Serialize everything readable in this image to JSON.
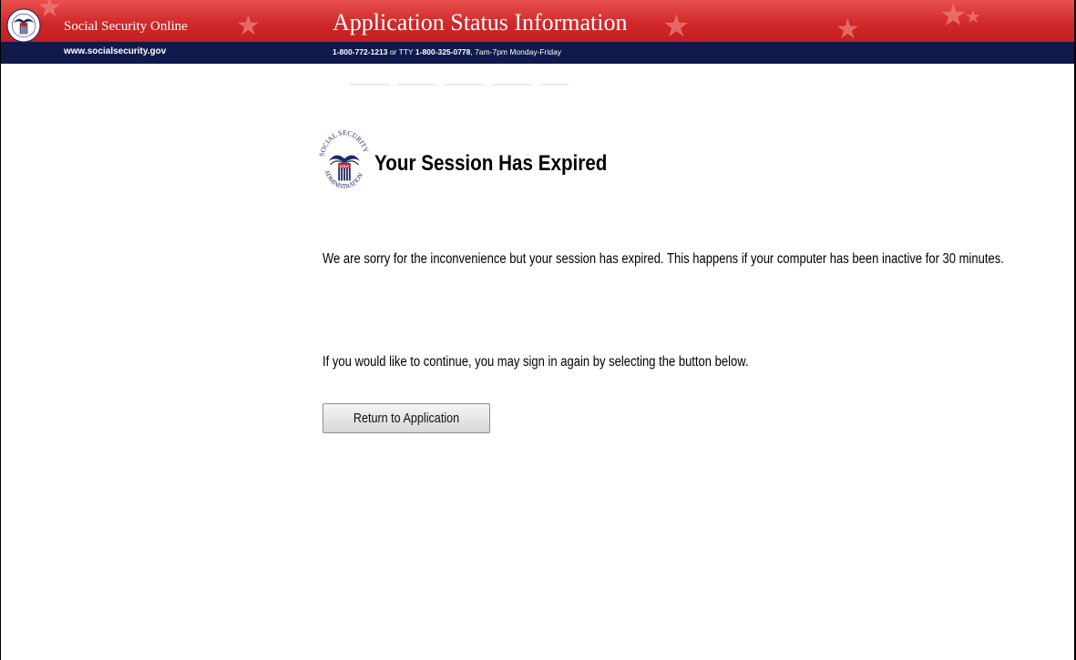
{
  "header": {
    "site_name": "Social Security Online",
    "site_url": "www.socialsecurity.gov",
    "title": "Application Status Information",
    "phone_main": "1-800-772-1213",
    "phone_or": " or TTY ",
    "phone_tty": "1-800-325-0778",
    "phone_hours": ", 7am-7pm Monday-Friday",
    "seal_icon": "ssa-seal-icon",
    "colors": {
      "red_band": "#d1292a",
      "navy_bar": "#111a4d"
    }
  },
  "main": {
    "seal_icon": "ssa-seal-icon",
    "title": "Your Session Has Expired",
    "paragraph1": "We are sorry for the inconvenience but your session has expired. This happens if your computer has been inactive for 30 minutes.",
    "paragraph2": "If you would like to continue, you may sign in again by selecting the button below.",
    "return_button_label": "Return to Application"
  }
}
